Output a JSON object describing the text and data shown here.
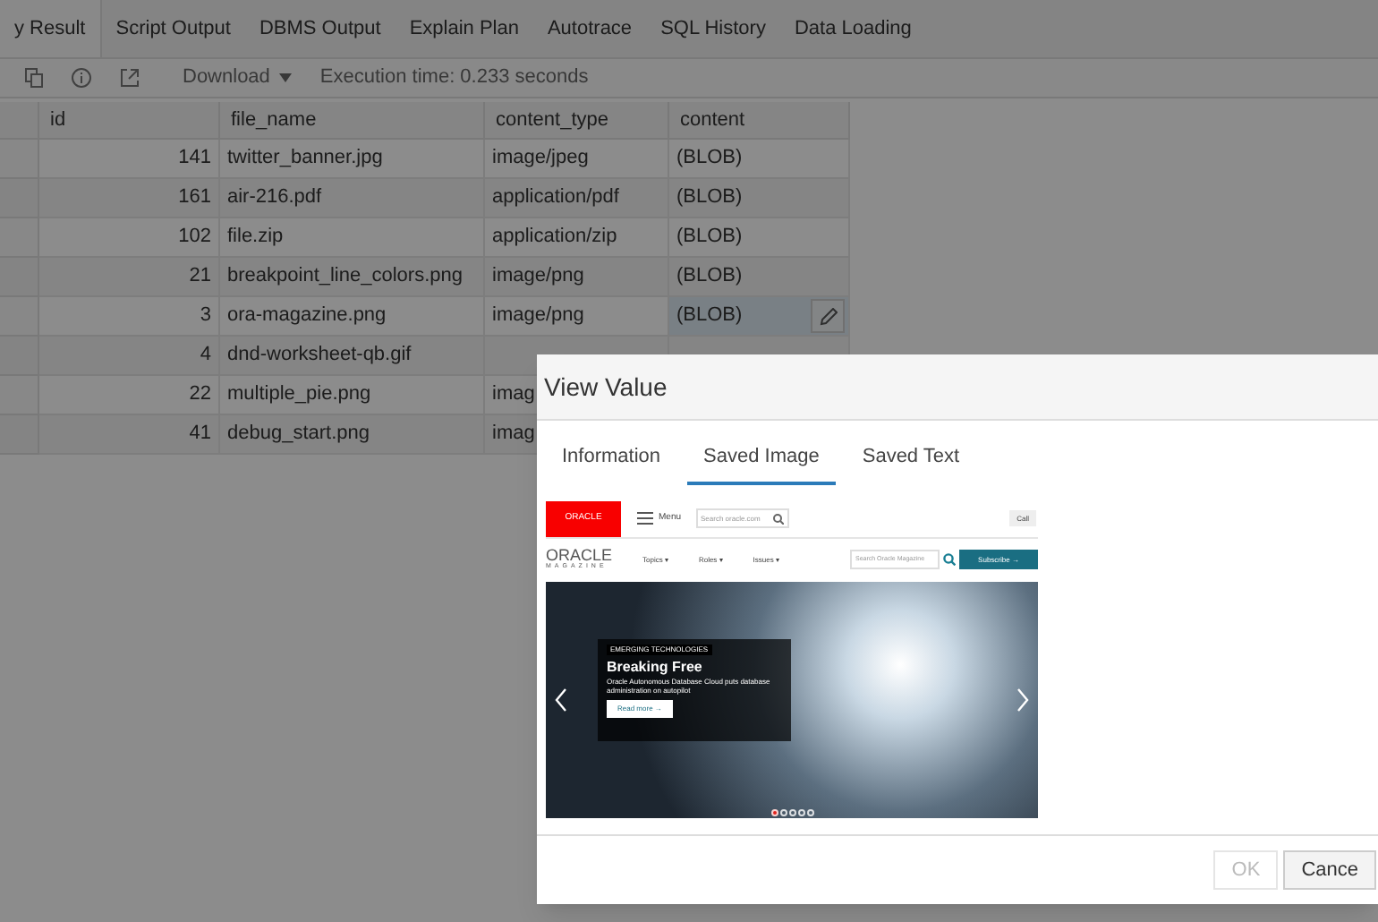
{
  "tabs": [
    {
      "label": "y Result",
      "selected": true
    },
    {
      "label": "Script Output",
      "selected": false
    },
    {
      "label": "DBMS Output",
      "selected": false
    },
    {
      "label": "Explain Plan",
      "selected": false
    },
    {
      "label": "Autotrace",
      "selected": false
    },
    {
      "label": "SQL History",
      "selected": false
    },
    {
      "label": "Data Loading",
      "selected": false
    }
  ],
  "toolbar": {
    "download": "Download",
    "execution_time": "Execution time: 0.233 seconds"
  },
  "table": {
    "columns": [
      "id",
      "file_name",
      "content_type",
      "content"
    ],
    "rows": [
      {
        "id": "141",
        "file_name": "twitter_banner.jpg",
        "content_type": "image/jpeg",
        "content": "(BLOB)",
        "selected": false
      },
      {
        "id": "161",
        "file_name": "air-216.pdf",
        "content_type": "application/pdf",
        "content": "(BLOB)",
        "selected": false
      },
      {
        "id": "102",
        "file_name": "file.zip",
        "content_type": "application/zip",
        "content": "(BLOB)",
        "selected": false
      },
      {
        "id": "21",
        "file_name": "breakpoint_line_colors.png",
        "content_type": "image/png",
        "content": "(BLOB)",
        "selected": false
      },
      {
        "id": "3",
        "file_name": "ora-magazine.png",
        "content_type": "image/png",
        "content": "(BLOB)",
        "selected": true
      },
      {
        "id": "4",
        "file_name": "dnd-worksheet-qb.gif",
        "selected": false
      },
      {
        "id": "22",
        "file_name": "multiple_pie.png",
        "content_type": "imag",
        "selected": false
      },
      {
        "id": "41",
        "file_name": "debug_start.png",
        "content_type": "imag",
        "selected": false
      }
    ]
  },
  "dialog": {
    "title": "View Value",
    "tabs": [
      {
        "label": "Information",
        "selected": false
      },
      {
        "label": "Saved Image",
        "selected": true
      },
      {
        "label": "Saved Text",
        "selected": false
      }
    ],
    "image": {
      "logo": "ORACLE",
      "menu": "Menu",
      "search": "Search oracle.com",
      "call": "Call",
      "magazine_logo": "ORACLE",
      "magazine_sub": "MAGAZINE",
      "nav": [
        "Topics ▾",
        "Roles ▾",
        "Issues ▾"
      ],
      "magazine_search": "Search Oracle Magazine",
      "subscribe": "Subscribe →",
      "hero": {
        "tag": "EMERGING TECHNOLOGIES",
        "headline": "Breaking Free",
        "text": "Oracle Autonomous Database Cloud puts database administration on autopilot",
        "button": "Read more →"
      },
      "slides": [
        {
          "selected": true
        },
        {
          "selected": false
        },
        {
          "selected": false
        },
        {
          "selected": false
        },
        {
          "selected": false
        }
      ]
    },
    "buttons": [
      {
        "label": "OK",
        "disabled": true
      },
      {
        "label": "Cance",
        "disabled": false
      }
    ]
  }
}
